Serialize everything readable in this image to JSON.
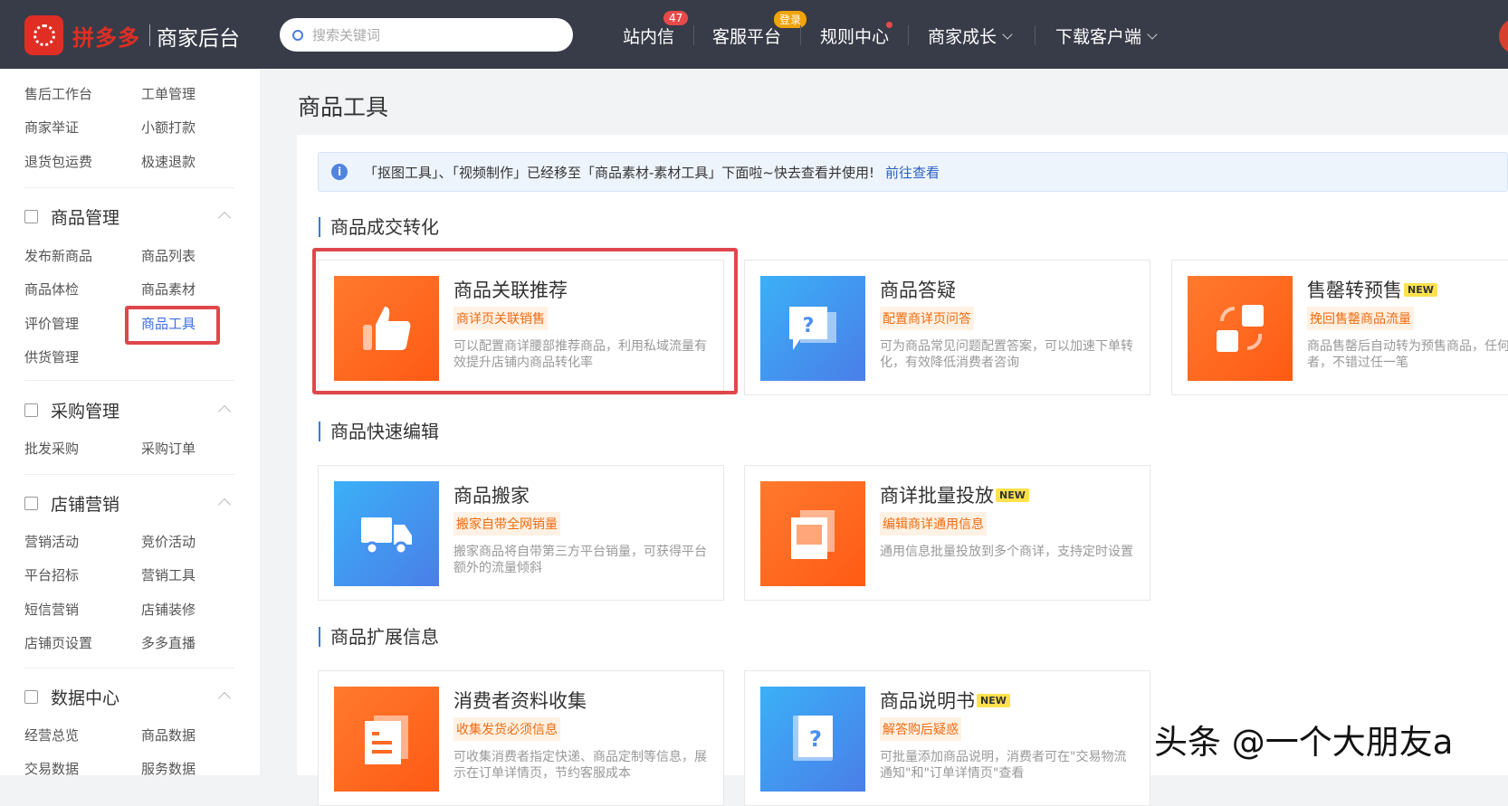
{
  "header": {
    "logo_text": "拼多多",
    "logo_sub": "商家后台",
    "search_placeholder": "搜索关键词",
    "nav": [
      {
        "label": "站内信",
        "badge": "47"
      },
      {
        "label": "客服平台",
        "badge": "登录"
      },
      {
        "label": "规则中心"
      },
      {
        "label": "商家成长"
      },
      {
        "label": "下载客户端"
      }
    ]
  },
  "sidebar": {
    "top_items": [
      "售后工作台",
      "工单管理",
      "商家举证",
      "小额打款",
      "退货包运费",
      "极速退款"
    ],
    "sections": [
      {
        "title": "商品管理",
        "items": [
          "发布新商品",
          "商品列表",
          "商品体检",
          "商品素材",
          "评价管理",
          "商品工具",
          "供货管理"
        ]
      },
      {
        "title": "采购管理",
        "items": [
          "批发采购",
          "采购订单"
        ]
      },
      {
        "title": "店铺营销",
        "items": [
          "营销活动",
          "竞价活动",
          "平台招标",
          "营销工具",
          "短信营销",
          "店铺装修",
          "店铺页设置",
          "多多直播"
        ]
      },
      {
        "title": "数据中心",
        "items": [
          "经营总览",
          "商品数据",
          "交易数据",
          "服务数据"
        ]
      }
    ],
    "active_item": "商品工具"
  },
  "main": {
    "title": "商品工具",
    "notice": {
      "text": "「抠图工具」、「视频制作」已经移至「商品素材-素材工具」下面啦~快去查看并使用!",
      "link": "前往查看"
    },
    "sections": [
      {
        "title": "商品成交转化",
        "cards": [
          {
            "title": "商品关联推荐",
            "tag": "商详页关联销售",
            "desc": "可以配置商详腰部推荐商品，利用私域流量有效提升店铺内商品转化率",
            "color": "orange",
            "icon": "thumbs-up-icon"
          },
          {
            "title": "商品答疑",
            "tag": "配置商详页问答",
            "desc": "可为商品常见问题配置答案，可以加速下单转化，有效降低消费者咨询",
            "color": "blue",
            "icon": "question-chat-icon"
          },
          {
            "title": "售罄转预售",
            "new": "NEW",
            "tag": "挽回售罄商品流量",
            "desc": "商品售罄后自动转为预售商品，任何一个消费者，不错过任一笔",
            "color": "orange",
            "icon": "refresh-swap-icon"
          }
        ]
      },
      {
        "title": "商品快速编辑",
        "cards": [
          {
            "title": "商品搬家",
            "tag": "搬家自带全网销量",
            "desc": "搬家商品将自带第三方平台销量，可获得平台额外的流量倾斜",
            "color": "blue",
            "icon": "truck-icon"
          },
          {
            "title": "商详批量投放",
            "new": "NEW",
            "tag": "编辑商详通用信息",
            "desc": "通用信息批量投放到多个商详，支持定时设置",
            "color": "orange",
            "icon": "image-stack-icon"
          }
        ]
      },
      {
        "title": "商品扩展信息",
        "cards": [
          {
            "title": "消费者资料收集",
            "tag": "收集发货必须信息",
            "desc": "可收集消费者指定快递、商品定制等信息，展示在订单详情页，节约客服成本",
            "color": "orange",
            "icon": "document-icon"
          },
          {
            "title": "商品说明书",
            "new": "NEW",
            "tag": "解答购后疑惑",
            "desc": "可批量添加商品说明，消费者可在\"交易物流通知\"和\"订单详情页\"查看",
            "color": "blue",
            "icon": "manual-book-icon"
          }
        ]
      }
    ]
  },
  "watermark": "头条 @一个大朋友a"
}
